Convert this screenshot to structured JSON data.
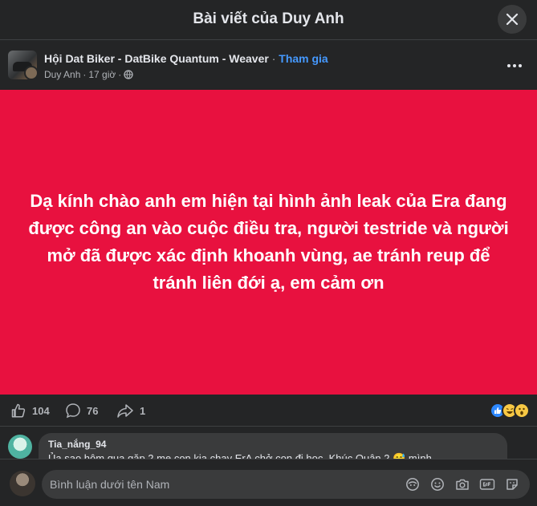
{
  "modal": {
    "title": "Bài viết của Duy Anh"
  },
  "post": {
    "group_name": "Hội Dat Biker - DatBike Quantum - Weaver",
    "separator": " · ",
    "join_label": "Tham gia",
    "author": "Duy Anh",
    "time": "17 giờ",
    "meta_sep": " · ",
    "image_text": "Dạ kính chào anh em hiện tại hình ảnh leak của Era đang được công an vào cuộc điều tra, người testride và người mở đã được xác định khoanh vùng, ae tránh reup để tránh liên đới ạ, em cảm ơn",
    "image_bg_color": "#e8113f"
  },
  "stats": {
    "likes": "104",
    "comments": "76",
    "shares": "1"
  },
  "comment": {
    "author": "Tia_nắng_94",
    "text": "Ủa sao hôm qua gặp 2 mẹ con kia chạy ErA chở con đi học, Khúc Quận 2 😅 mình"
  },
  "compose": {
    "placeholder": "Bình luận dưới tên Nam"
  }
}
